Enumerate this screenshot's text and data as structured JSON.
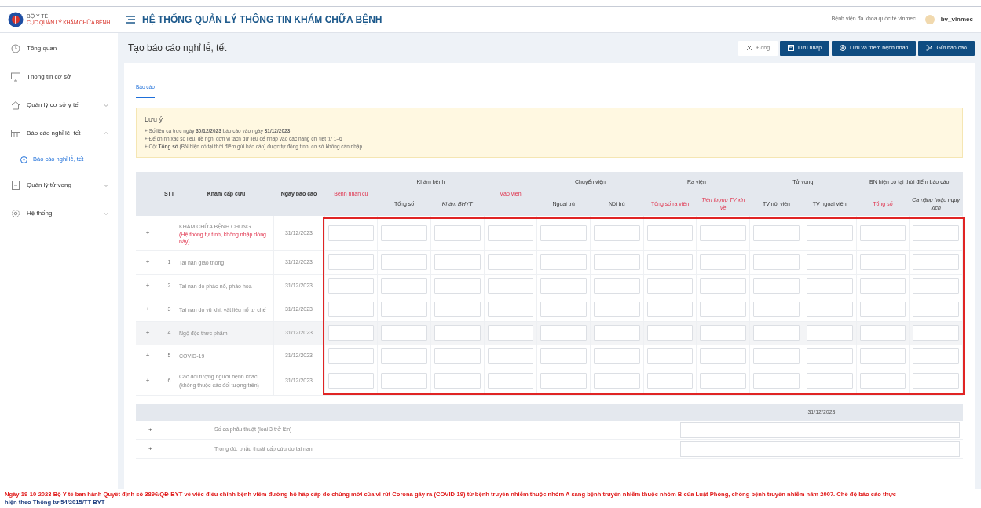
{
  "header": {
    "logo_line1": "BỘ Y TẾ",
    "logo_line2": "CỤC QUẢN LÝ KHÁM CHỮA BỆNH",
    "title": "HỆ THỐNG QUẢN LÝ THÔNG TIN KHÁM CHỮA BỆNH",
    "hospital": "Bệnh viện đa khoa quốc tế vinmec",
    "username": "bv_vinmec"
  },
  "sidebar": {
    "items": [
      {
        "label": "Tổng quan",
        "selected": false
      },
      {
        "label": "Thông tin cơ sở",
        "selected": false
      },
      {
        "label": "Quản lý cơ sở y tế",
        "expanded": false,
        "selected": false
      },
      {
        "label": "Báo cáo nghỉ lễ, tết",
        "expanded": true,
        "selected": false,
        "children": [
          {
            "label": "Báo cáo nghỉ lễ, tết",
            "selected": true
          }
        ]
      },
      {
        "label": "Quản lý tử vong",
        "expanded": false,
        "selected": false
      },
      {
        "label": "Hệ thống",
        "expanded": false,
        "selected": false
      }
    ]
  },
  "page": {
    "title": "Tạo báo cáo nghỉ lễ, tết",
    "actions": [
      {
        "label": "Đóng",
        "kind": "close"
      },
      {
        "label": "Lưu nháp",
        "kind": "save"
      },
      {
        "label": "Lưu và thêm bệnh nhân",
        "kind": "add"
      },
      {
        "label": "Gửi báo cáo",
        "kind": "send"
      }
    ],
    "tabs": [
      {
        "label": "Báo cáo",
        "selected": true
      }
    ],
    "notice": {
      "title": "Lưu ý",
      "lines": [
        "+ Số liệu ca trực ngày **30/12/2023** báo cáo vào ngày **31/12/2023**",
        "+ Để chính xác số liệu, đề nghị đơn vị tách dữ liệu để nhập vào các hàng chi tiết từ 1–6",
        "+ Cột **Tổng số** (BN hiện có tại thời điểm gửi báo cáo) được tự động tính, cơ sở không cần nhập."
      ]
    }
  },
  "table": {
    "fixed_columns": [
      "STT",
      "Khám cấp cứu",
      "Ngày báo cáo"
    ],
    "value_columns": [
      {
        "label": "Bệnh nhân cũ",
        "required": true,
        "italic": false
      },
      {
        "group": "Khám bệnh",
        "columns": [
          {
            "label": "Tổng số",
            "required": false,
            "italic": false
          },
          {
            "label": "Khám BHYT",
            "required": false,
            "italic": true
          }
        ]
      },
      {
        "label": "Vào viện",
        "required": true,
        "italic": false
      },
      {
        "group": "Chuyển viện",
        "columns": [
          {
            "label": "Ngoại trú",
            "required": false,
            "italic": false
          },
          {
            "label": "Nội trú",
            "required": false,
            "italic": false
          }
        ]
      },
      {
        "group": "Ra viện",
        "columns": [
          {
            "label": "Tổng số ra viện",
            "required": true,
            "italic": false
          },
          {
            "label": "Tiên lượng TV xin về",
            "required": true,
            "italic": true
          }
        ]
      },
      {
        "group": "Tử vong",
        "columns": [
          {
            "label": "TV nội viện",
            "required": false,
            "italic": false
          },
          {
            "label": "TV ngoại viện",
            "required": false,
            "italic": false
          }
        ]
      },
      {
        "group": "BN hiện có tại thời điểm báo cáo",
        "columns": [
          {
            "label": "Tổng số",
            "required": true,
            "italic": false
          },
          {
            "label": "Ca nặng hoặc nguy kịch",
            "required": false,
            "italic": true
          }
        ]
      }
    ],
    "rows": [
      {
        "expand": "+",
        "stt": "",
        "name": "KHÁM CHỮA BỆNH CHUNG",
        "note": "(Hệ thống tự tính, không nhập dòng này)",
        "date": "31/12/2023",
        "hovered": false
      },
      {
        "expand": "+",
        "stt": "1",
        "name": "Tai nạn giao thông",
        "date": "31/12/2023",
        "hovered": false
      },
      {
        "expand": "+",
        "stt": "2",
        "name": "Tai nạn do pháo nổ, pháo hoa",
        "date": "31/12/2023",
        "hovered": false
      },
      {
        "expand": "+",
        "stt": "3",
        "name": "Tai nạn do vũ khí, vật liệu nổ tự chế",
        "date": "31/12/2023",
        "hovered": false
      },
      {
        "expand": "+",
        "stt": "4",
        "name": "Ngộ độc thực phẩm",
        "date": "31/12/2023",
        "hovered": true
      },
      {
        "expand": "+",
        "stt": "5",
        "name": "COVID-19",
        "date": "31/12/2023",
        "hovered": false
      },
      {
        "expand": "+",
        "stt": "6",
        "name": "Các đối tượng người bệnh khác (không thuộc các đối tượng trên)",
        "date": "31/12/2023",
        "hovered": false
      }
    ],
    "input_area_highlighted": true
  },
  "surgery_table": {
    "date": "31/12/2023",
    "rows": [
      {
        "expand": "+",
        "label": "Số ca phẫu thuật (loại 3 trở lên)"
      },
      {
        "expand": "+",
        "label": "Trong đó: phẫu thuật cấp cứu do tai nạn"
      }
    ]
  },
  "announcement": {
    "text": "Ngày 19-10-2023 Bộ Y tế ban hành Quyết định số 3896/QĐ-BYT về việc điều chỉnh bệnh viêm đường hô hấp cấp do chủng mới của vi rút Corona gây ra (COVID-19) từ bệnh truyền nhiễm thuộc nhóm A sang bệnh truyền nhiễm thuộc nhóm B của Luật Phòng, chống bệnh truyền nhiễm năm 2007. Chế độ báo cáo thực",
    "continuation": "hiện theo Thông tư 54/2015/TT-BYT"
  }
}
